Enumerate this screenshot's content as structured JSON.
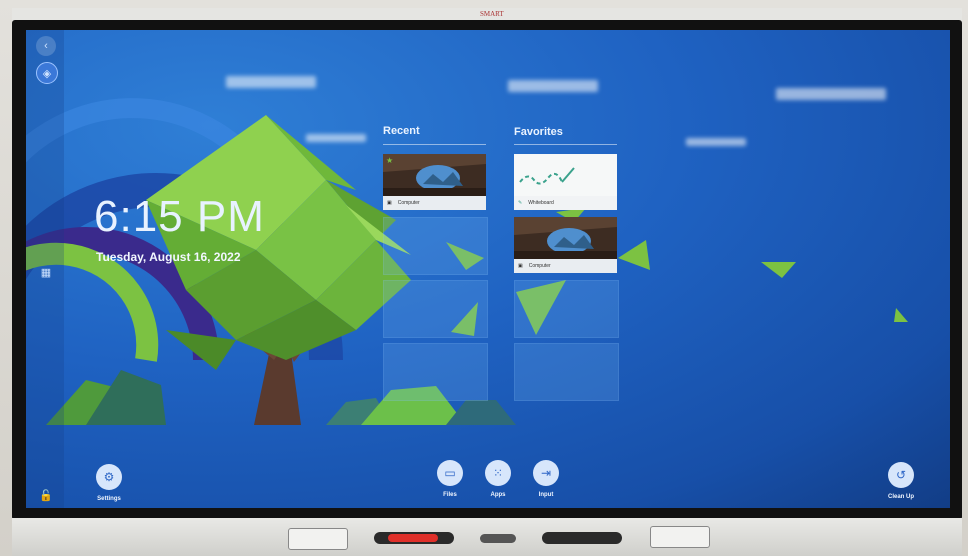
{
  "device": {
    "brand": "SMART"
  },
  "clock": {
    "time": "6:15 PM",
    "date": "Tuesday, August 16, 2022"
  },
  "sections": {
    "recent": {
      "title": "Recent",
      "items": [
        {
          "label": "Computer"
        }
      ]
    },
    "favorites": {
      "title": "Favorites",
      "items": [
        {
          "label": "Whiteboard"
        },
        {
          "label": "Computer"
        }
      ]
    }
  },
  "dock": {
    "settings": "Settings",
    "files": "Files",
    "apps": "Apps",
    "input": "Input",
    "cleanup": "Clean Up"
  },
  "icons": {
    "sidebar": [
      "back-icon",
      "smart-hub-icon",
      "widgets-icon"
    ],
    "lock": "lock-icon",
    "settings": "gear-icon",
    "files": "folder-icon",
    "apps": "grid-icon",
    "input": "input-icon",
    "cleanup": "undo-icon"
  },
  "colors": {
    "screen_bg": "#1f62c2",
    "tree_green": "#7cc242",
    "dock_button": "#d7e6fb"
  }
}
